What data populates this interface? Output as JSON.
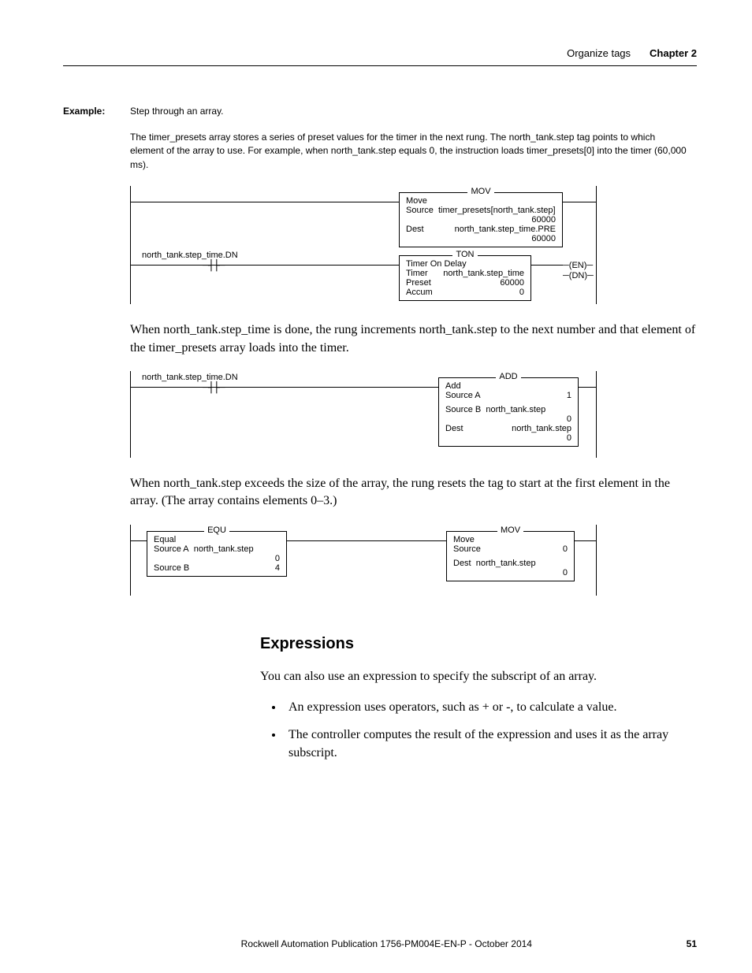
{
  "header": {
    "section": "Organize tags",
    "chapter": "Chapter 2"
  },
  "example": {
    "label": "Example:",
    "title": "Step through an array.",
    "desc": "The timer_presets array stores a series of preset values for the timer in the next rung. The north_tank.step tag points to which element of the array to use. For example, when north_tank.step equals 0, the instruction loads timer_presets[0] into the timer (60,000 ms)."
  },
  "diagram1": {
    "mov": {
      "op": "MOV",
      "l1": "Move",
      "l2": "Source",
      "v2": "timer_presets[north_tank.step]",
      "r2": "60000",
      "l3": "Dest",
      "v3": "north_tank.step_time.PRE",
      "r3": "60000"
    },
    "contact": {
      "tag": "north_tank.step_time.DN"
    },
    "ton": {
      "op": "TON",
      "l1": "Timer On Delay",
      "l2": "Timer",
      "v2": "north_tank.step_time",
      "l3": "Preset",
      "v3": "60000",
      "l4": "Accum",
      "v4": "0",
      "en": "EN",
      "dn": "DN"
    }
  },
  "para1": "When north_tank.step_time is done, the rung increments north_tank.step to the next number and that element of the timer_presets array loads into the timer.",
  "diagram2": {
    "contact": {
      "tag": "north_tank.step_time.DN"
    },
    "add": {
      "op": "ADD",
      "l1": "Add",
      "l2": "Source A",
      "v2": "1",
      "l3": "Source B",
      "v3": "north_tank.step",
      "r3": "0",
      "l4": "Dest",
      "v4": "north_tank.step",
      "r4": "0"
    }
  },
  "para2": "When north_tank.step exceeds the size of the array, the rung resets the tag to start at the first element in the array. (The array contains elements 0–3.)",
  "diagram3": {
    "equ": {
      "op": "EQU",
      "l1": "Equal",
      "l2": "Source A",
      "v2": "north_tank.step",
      "r2": "0",
      "l3": "Source B",
      "v3": "4"
    },
    "mov": {
      "op": "MOV",
      "l1": "Move",
      "l2": "Source",
      "v2": "0",
      "l3": "Dest",
      "v3": "north_tank.step",
      "r3": "0"
    }
  },
  "expressions": {
    "title": "Expressions",
    "intro": "You can also use an expression to specify the subscript of an array.",
    "b1": "An expression uses operators, such as + or -, to calculate a value.",
    "b2": "The controller computes the result of the expression and uses it as the array subscript."
  },
  "footer": {
    "line": "Rockwell Automation Publication 1756-PM004E-EN-P - October 2014",
    "page": "51"
  }
}
